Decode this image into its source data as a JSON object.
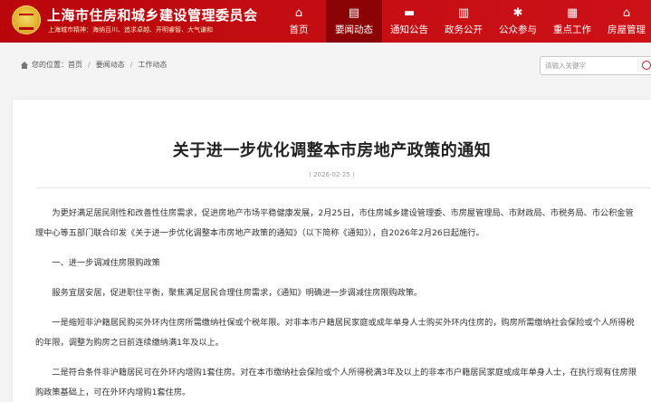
{
  "header": {
    "site_title": "上海市住房和城乡建设管理委员会",
    "slogan": "上海城市精神：海纳百川、追求卓越、开明睿智、大气谦和",
    "brand_color": "#c30d12",
    "active_color": "#8c0306",
    "nav": [
      {
        "icon": "home-icon",
        "glyph": "⌂",
        "label": "首页"
      },
      {
        "icon": "news-icon",
        "glyph": "▤",
        "label": "要闻动态"
      },
      {
        "icon": "folder-icon",
        "glyph": "▬",
        "label": "通知公告"
      },
      {
        "icon": "chart-icon",
        "glyph": "▥",
        "label": "政务公开"
      },
      {
        "icon": "gear-icon",
        "glyph": "✱",
        "label": "公众参与"
      },
      {
        "icon": "building-icon",
        "glyph": "▦",
        "label": "重点工作"
      },
      {
        "icon": "house-gear-icon",
        "glyph": "⌂",
        "label": "房屋管理"
      }
    ],
    "active_nav_index": 1
  },
  "breadcrumb": {
    "prefix": "您的位置：",
    "items": [
      "首页",
      "要闻动态",
      "工作动态"
    ],
    "separator": "/"
  },
  "search": {
    "placeholder": "请输入关键字",
    "value": ""
  },
  "article": {
    "title": "关于进一步优化调整本市房地产政策的通知",
    "date": "( 2026-02-25 )",
    "paragraphs": [
      "为更好满足居民刚性和改善性住房需求，促进房地产市场平稳健康发展，2月25日，市住房城乡建设管理委、市房屋管理局、市财政局、市税务局、市公积金管理中心等五部门联合印发《关于进一步优化调整本市房地产政策的通知》（以下简称《通知》），自2026年2月26日起施行。",
      "一、进一步调减住房限购政策",
      "服务宜居安居，促进职住平衡，聚焦满足居民合理住房需求，《通知》明确进一步调减住房限购政策。",
      "一是缩短非沪籍居民购买外环内住房所需缴纳社保或个税年限。对非本市户籍居民家庭或成年单身人士购买外环内住房的，购房所需缴纳社会保险或个人所得税的年限，调整为购房之日前连续缴纳满1年及以上。",
      "二是符合条件非沪籍居民可在外环内增购1套住房。对在本市缴纳社会保险或个人所得税满3年及以上的非本市户籍居民家庭或成年单身人士，在执行现有住房限购政策基础上，可在外环内增购1套住房。"
    ]
  }
}
